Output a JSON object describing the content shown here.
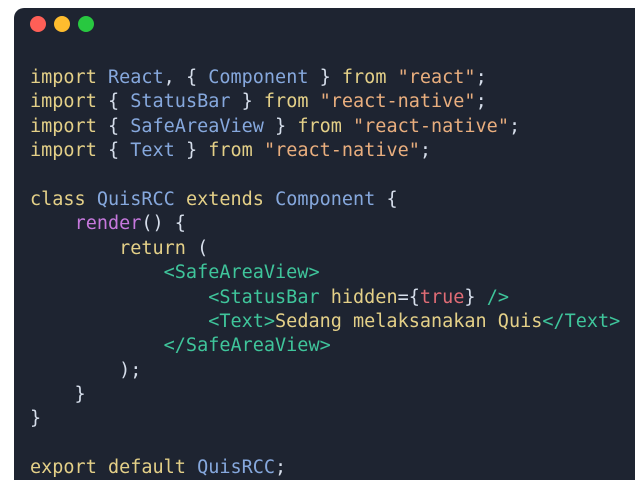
{
  "window": {
    "controls": [
      {
        "name": "close",
        "color": "#fe5f57"
      },
      {
        "name": "minimize",
        "color": "#febc2e"
      },
      {
        "name": "zoom",
        "color": "#28c840"
      }
    ]
  },
  "colors": {
    "background": "#1e2431",
    "keyword": "#e4d088",
    "string": "#e9ae7e",
    "identifier": "#86a8dd",
    "function": "#c678dd",
    "jsx_tag": "#3fc59b",
    "boolean": "#e06c75",
    "plain": "#d6deeb"
  },
  "code": {
    "lines": [
      [
        [
          "kw",
          "import"
        ],
        [
          "pl",
          " "
        ],
        [
          "id",
          "React"
        ],
        [
          "pl",
          ", { "
        ],
        [
          "id",
          "Component"
        ],
        [
          "pl",
          " } "
        ],
        [
          "kw",
          "from"
        ],
        [
          "pl",
          " "
        ],
        [
          "str",
          "\"react\""
        ],
        [
          "pl",
          ";"
        ]
      ],
      [
        [
          "kw",
          "import"
        ],
        [
          "pl",
          " { "
        ],
        [
          "id",
          "StatusBar"
        ],
        [
          "pl",
          " } "
        ],
        [
          "kw",
          "from"
        ],
        [
          "pl",
          " "
        ],
        [
          "str",
          "\"react-native\""
        ],
        [
          "pl",
          ";"
        ]
      ],
      [
        [
          "kw",
          "import"
        ],
        [
          "pl",
          " { "
        ],
        [
          "id",
          "SafeAreaView"
        ],
        [
          "pl",
          " } "
        ],
        [
          "kw",
          "from"
        ],
        [
          "pl",
          " "
        ],
        [
          "str",
          "\"react-native\""
        ],
        [
          "pl",
          ";"
        ]
      ],
      [
        [
          "kw",
          "import"
        ],
        [
          "pl",
          " { "
        ],
        [
          "id",
          "Text"
        ],
        [
          "pl",
          " } "
        ],
        [
          "kw",
          "from"
        ],
        [
          "pl",
          " "
        ],
        [
          "str",
          "\"react-native\""
        ],
        [
          "pl",
          ";"
        ]
      ],
      [],
      [
        [
          "kw",
          "class"
        ],
        [
          "pl",
          " "
        ],
        [
          "id",
          "QuisRCC"
        ],
        [
          "pl",
          " "
        ],
        [
          "kw",
          "extends"
        ],
        [
          "pl",
          " "
        ],
        [
          "id",
          "Component"
        ],
        [
          "pl",
          " {"
        ]
      ],
      [
        [
          "pl",
          "    "
        ],
        [
          "fn",
          "render"
        ],
        [
          "pl",
          "() {"
        ]
      ],
      [
        [
          "pl",
          "        "
        ],
        [
          "kw",
          "return"
        ],
        [
          "pl",
          " ("
        ]
      ],
      [
        [
          "pl",
          "            "
        ],
        [
          "jsx",
          "<SafeAreaView>"
        ]
      ],
      [
        [
          "pl",
          "                "
        ],
        [
          "jsx",
          "<StatusBar "
        ],
        [
          "kw",
          "hidden"
        ],
        [
          "pl",
          "={"
        ],
        [
          "bool",
          "true"
        ],
        [
          "pl",
          "} "
        ],
        [
          "jsx",
          "/>"
        ]
      ],
      [
        [
          "pl",
          "                "
        ],
        [
          "jsx",
          "<Text>"
        ],
        [
          "kw",
          "Sedang melaksanakan Quis"
        ],
        [
          "jsx",
          "</Text>"
        ]
      ],
      [
        [
          "pl",
          "            "
        ],
        [
          "jsx",
          "</SafeAreaView>"
        ]
      ],
      [
        [
          "pl",
          "        );"
        ]
      ],
      [
        [
          "pl",
          "    }"
        ]
      ],
      [
        [
          "pl",
          "}"
        ]
      ],
      [],
      [
        [
          "kw",
          "export"
        ],
        [
          "pl",
          " "
        ],
        [
          "kw",
          "default"
        ],
        [
          "pl",
          " "
        ],
        [
          "id",
          "QuisRCC"
        ],
        [
          "pl",
          ";"
        ]
      ]
    ]
  }
}
